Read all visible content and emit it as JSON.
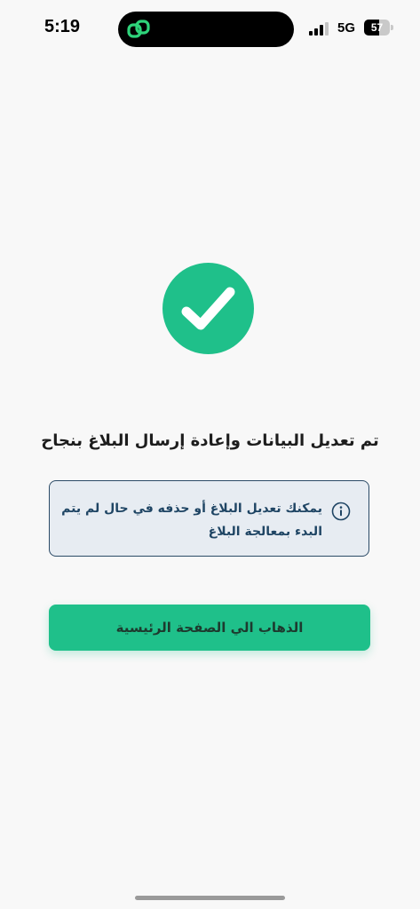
{
  "status_bar": {
    "time": "5:19",
    "network": "5G",
    "battery_percent": "57",
    "battery_level": 0.57,
    "signal_bars_active": 3,
    "island_icon": "link-rings-icon",
    "island_icon_color": "#2ed37a"
  },
  "main": {
    "success_icon": "checkmark-circle-icon",
    "success_color": "#1fc08a",
    "title": "تم تعديل البيانات وإعادة إرسال البلاغ بنجاح",
    "info": {
      "icon": "info-icon",
      "line1": "يمكنك تعديل البلاغ أو حذفه في حال لم يتم",
      "line2": "البدء بمعالجة البلاغ"
    },
    "home_button_label": "الذهاب الي الصفحة الرئيسية"
  },
  "colors": {
    "accent": "#1fc08a",
    "info_border": "#2b4a66",
    "info_background": "#e7ecf2",
    "info_text": "#1f4564",
    "background": "#f8f8f8"
  }
}
